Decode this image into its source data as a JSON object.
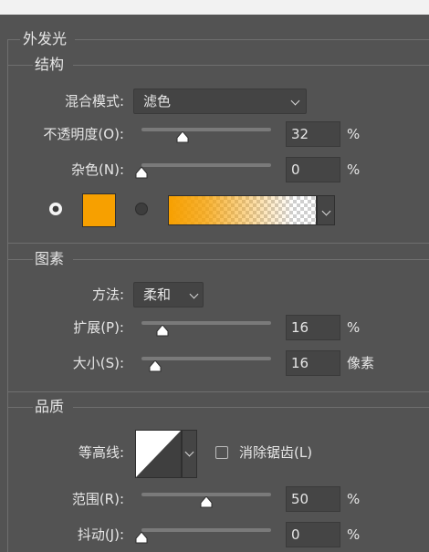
{
  "panel_title": "外发光",
  "sections": {
    "structure": "结构",
    "elements": "图素",
    "quality": "品质"
  },
  "structure": {
    "blend_mode_label": "混合模式:",
    "blend_mode_value": "滤色",
    "opacity_label": "不透明度(O):",
    "opacity_value": "32",
    "opacity_unit": "%",
    "opacity_fraction": 0.32,
    "noise_label": "杂色(N):",
    "noise_value": "0",
    "noise_unit": "%",
    "noise_fraction": 0,
    "color_swatch": "#f7a000",
    "gradient_start": "#f7a000"
  },
  "elements": {
    "technique_label": "方法:",
    "technique_value": "柔和",
    "spread_label": "扩展(P):",
    "spread_value": "16",
    "spread_unit": "%",
    "spread_fraction": 0.16,
    "size_label": "大小(S):",
    "size_value": "16",
    "size_unit": "像素"
  },
  "quality": {
    "contour_label": "等高线:",
    "antialias_label": "消除锯齿(L)",
    "antialias_checked": false,
    "range_label": "范围(R):",
    "range_value": "50",
    "range_unit": "%",
    "range_fraction": 0.5,
    "jitter_label": "抖动(J):",
    "jitter_value": "0",
    "jitter_unit": "%",
    "jitter_fraction": 0
  }
}
